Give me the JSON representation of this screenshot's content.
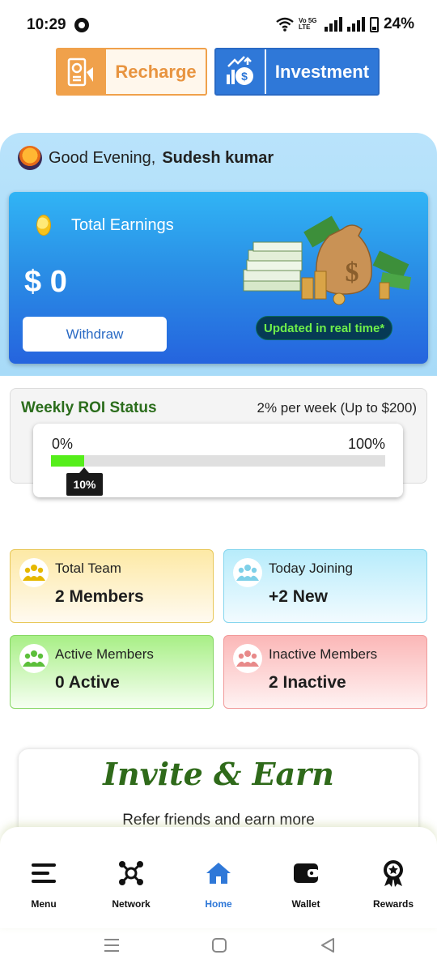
{
  "status": {
    "time": "10:29",
    "network": "Vo 5G LTE",
    "battery": "24%"
  },
  "top_buttons": {
    "recharge": "Recharge",
    "investment": "Investment"
  },
  "greeting": {
    "prefix": "Good Evening,",
    "name": "Sudesh kumar"
  },
  "earnings": {
    "label": "Total Earnings",
    "amount": "$ 0",
    "withdraw": "Withdraw",
    "badge": "Updated in real time*"
  },
  "roi": {
    "title": "Weekly ROI Status",
    "rate": "2% per week (Up to $200)",
    "min": "0%",
    "max": "100%",
    "progress": "10%",
    "progress_value": 0.1
  },
  "stats": [
    {
      "title": "Total Team",
      "value": "2 Members",
      "color": "#e6b800"
    },
    {
      "title": "Today Joining",
      "value": "+2 New",
      "color": "#7fd0e8"
    },
    {
      "title": "Active Members",
      "value": "0 Active",
      "color": "#5cbf3a"
    },
    {
      "title": "Inactive Members",
      "value": "2 Inactive",
      "color": "#e88a8a"
    }
  ],
  "invite": {
    "title": "Invite & Earn",
    "subtitle": "Refer friends and earn more"
  },
  "nav": {
    "menu": "Menu",
    "network": "Network",
    "home": "Home",
    "wallet": "Wallet",
    "rewards": "Rewards"
  },
  "colors": {
    "accent": "#2f78d8",
    "progress": "#55ee1a"
  }
}
